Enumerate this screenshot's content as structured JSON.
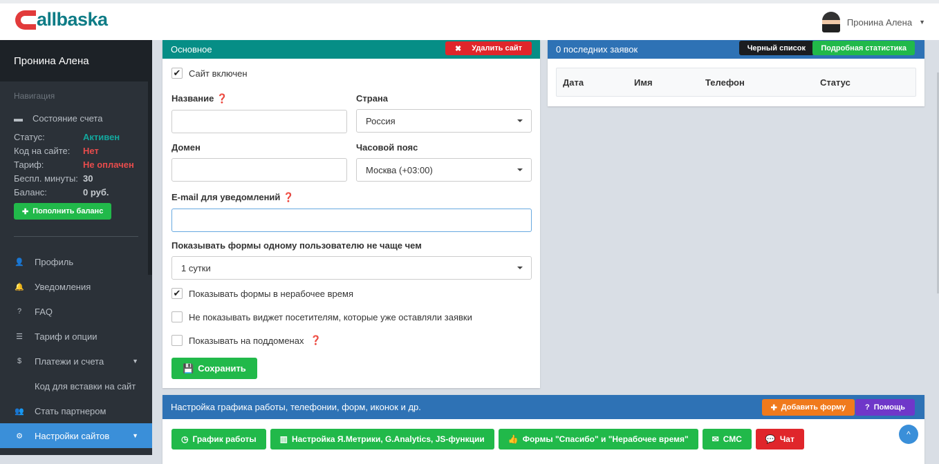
{
  "header": {
    "logo_text": "allbaska",
    "user_name": "Пронина Алена"
  },
  "sidebar": {
    "user_name": "Пронина Алена",
    "nav_label": "Навигация",
    "account": {
      "title": "Состояние счета",
      "rows": [
        {
          "k": "Статус:",
          "v": "Активен",
          "color": "#13a89e"
        },
        {
          "k": "Код на сайте:",
          "v": "Нет",
          "color": "#e84c4c"
        },
        {
          "k": "Тариф:",
          "v": "Не оплачен",
          "color": "#e84c4c"
        },
        {
          "k": "Беспл. минуты:",
          "v": "30",
          "color": "#c6cbd0"
        },
        {
          "k": "Баланс:",
          "v": "0 руб.",
          "color": "#c6cbd0"
        }
      ],
      "topup": "Пополнить баланс"
    },
    "items": [
      {
        "label": "Профиль",
        "icon": "user-icon"
      },
      {
        "label": "Уведомления",
        "icon": "bell-icon"
      },
      {
        "label": "FAQ",
        "icon": "question-icon"
      },
      {
        "label": "Тариф и опции",
        "icon": "list-icon"
      },
      {
        "label": "Платежи и счета",
        "icon": "dollar-icon"
      },
      {
        "label": "Код для вставки на сайт",
        "icon": "code-icon"
      },
      {
        "label": "Стать партнером",
        "icon": "users-icon"
      },
      {
        "label": "Настройки сайтов",
        "icon": "gears-icon"
      }
    ]
  },
  "main": {
    "title": "Основное",
    "delete": "Удалить сайт",
    "enabled": "Сайт включен",
    "name_label": "Название",
    "name_value": "",
    "country_label": "Страна",
    "country_value": "Россия",
    "domain_label": "Домен",
    "domain_value": "",
    "tz_label": "Часовой пояс",
    "tz_value": "Москва (+03:00)",
    "email_label": "E-mail для уведомлений",
    "email_value": "",
    "freq_label": "Показывать формы одному пользователю не чаще чем",
    "freq_value": "1 сутки",
    "chk1": "Показывать формы в нерабочее время",
    "chk2": "Не показывать виджет посетителям, которые уже оставляли заявки",
    "chk3": "Показывать на поддоменах",
    "save": "Сохранить"
  },
  "leads": {
    "title": "0 последних заявок",
    "blacklist": "Черный список",
    "stats": "Подробная статистика",
    "columns": [
      "Дата",
      "Имя",
      "Телефон",
      "Статус"
    ]
  },
  "settings": {
    "title": "Настройка графика работы, телефонии, форм, иконок и др.",
    "add_form": "Добавить форму",
    "help": "Помощь",
    "buttons": [
      "График работы",
      "Настройка Я.Метрики, G.Analytics, JS-функции",
      "Формы \"Спасибо\" и \"Нерабочее время\"",
      "СМС",
      "Чат"
    ]
  },
  "colors": {
    "teal": "#068e86",
    "blue": "#2e72b5",
    "green": "#21b94a",
    "red": "#e0262b",
    "orange": "#f07a1c",
    "purple": "#6f37c9"
  }
}
